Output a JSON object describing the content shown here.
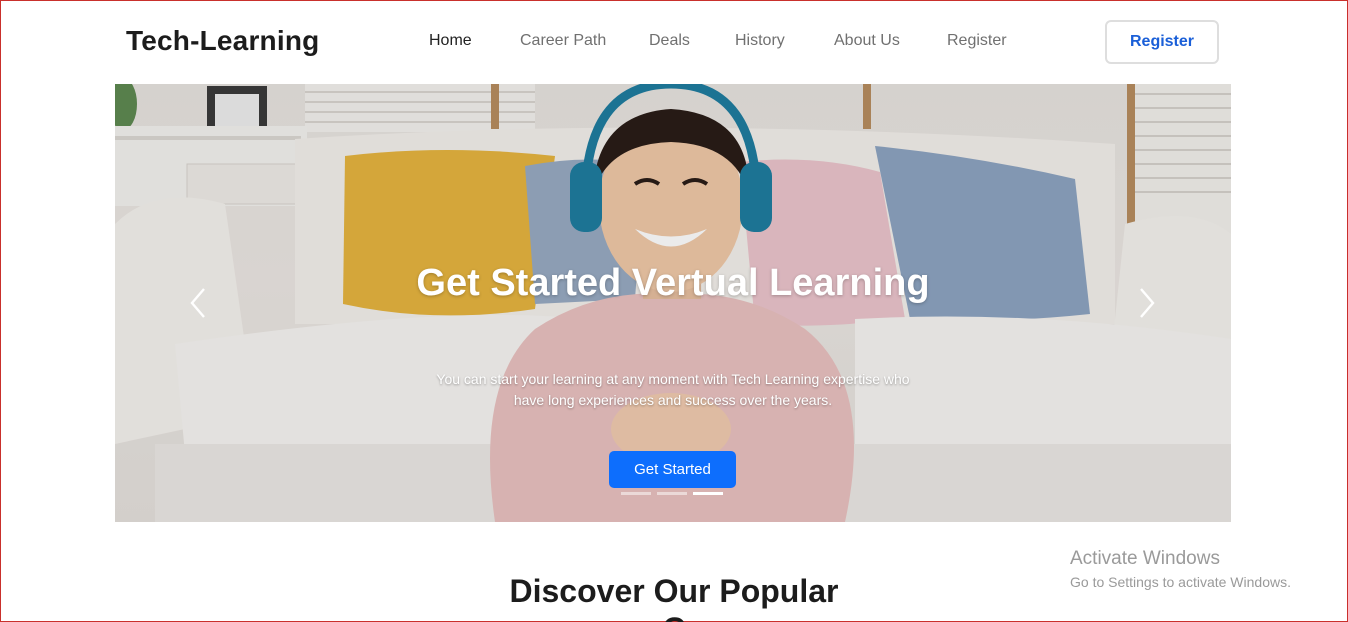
{
  "header": {
    "brand": "Tech-Learning",
    "nav": [
      {
        "label": "Home",
        "active": true
      },
      {
        "label": "Career Path",
        "active": false
      },
      {
        "label": "Deals",
        "active": false
      },
      {
        "label": "History",
        "active": false
      },
      {
        "label": "About Us",
        "active": false
      },
      {
        "label": "Register",
        "active": false
      }
    ],
    "register_button": "Register"
  },
  "hero": {
    "title": "Get Started Vertual Learning",
    "text": "You can start your learning at any moment with Tech Learning expertise who have long experiences and success over the years.",
    "cta": "Get Started",
    "slide_count": 3,
    "active_slide": 3,
    "prev_icon": "chevron-left-icon",
    "next_icon": "chevron-right-icon"
  },
  "section": {
    "heading": "Discover Our Popular",
    "heading_cont": "C"
  },
  "watermark": {
    "title": "Activate Windows",
    "subtitle": "Go to Settings to activate Windows."
  },
  "colors": {
    "primary": "#0d6efd",
    "brand_link": "#1a5fd8",
    "text_dark": "#1c1c1c",
    "nav_muted": "#707070"
  }
}
